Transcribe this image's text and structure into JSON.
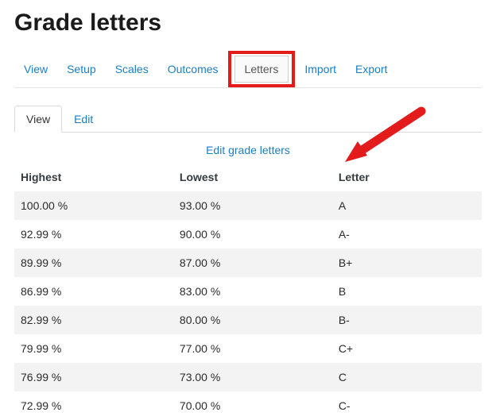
{
  "title": "Grade letters",
  "primaryTabs": {
    "view": "View",
    "setup": "Setup",
    "scales": "Scales",
    "outcomes": "Outcomes",
    "letters": "Letters",
    "import": "Import",
    "export": "Export"
  },
  "secondaryTabs": {
    "view": "View",
    "edit": "Edit"
  },
  "editLink": "Edit grade letters",
  "columns": {
    "highest": "Highest",
    "lowest": "Lowest",
    "letter": "Letter"
  },
  "rows": [
    {
      "highest": "100.00 %",
      "lowest": "93.00 %",
      "letter": "A"
    },
    {
      "highest": "92.99 %",
      "lowest": "90.00 %",
      "letter": "A-"
    },
    {
      "highest": "89.99 %",
      "lowest": "87.00 %",
      "letter": "B+"
    },
    {
      "highest": "86.99 %",
      "lowest": "83.00 %",
      "letter": "B"
    },
    {
      "highest": "82.99 %",
      "lowest": "80.00 %",
      "letter": "B-"
    },
    {
      "highest": "79.99 %",
      "lowest": "77.00 %",
      "letter": "C+"
    },
    {
      "highest": "76.99 %",
      "lowest": "73.00 %",
      "letter": "C"
    },
    {
      "highest": "72.99 %",
      "lowest": "70.00 %",
      "letter": "C-"
    }
  ]
}
